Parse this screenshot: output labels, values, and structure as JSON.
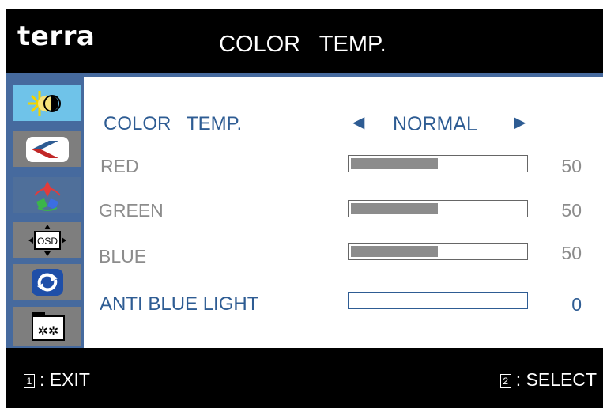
{
  "header": {
    "brand": "terra",
    "title": "COLOR   TEMP."
  },
  "sidebar": {
    "items": [
      {
        "icon": "brightness-contrast-icon",
        "active": true
      },
      {
        "icon": "image-adjust-icon"
      },
      {
        "icon": "color-icon",
        "active": true
      },
      {
        "icon": "osd-settings-icon"
      },
      {
        "icon": "reset-icon"
      },
      {
        "icon": "setup-icon"
      }
    ]
  },
  "menu": {
    "color_temp": {
      "label": "COLOR   TEMP.",
      "value": "NORMAL",
      "prev_arrow": "◀",
      "next_arrow": "▶"
    },
    "red": {
      "label": "RED",
      "value": 50
    },
    "green": {
      "label": "GREEN",
      "value": 50
    },
    "blue": {
      "label": "BLUE",
      "value": 50
    },
    "anti_blue_light": {
      "label": "ANTI BLUE LIGHT",
      "value": 0
    }
  },
  "footer": {
    "exit": {
      "key": "1",
      "label": ": EXIT"
    },
    "select": {
      "key": "2",
      "label": ": SELECT"
    }
  },
  "colors": {
    "accent": "#2e5c93",
    "sidebar": "#466a9e",
    "active_icon": "#6fc3e9",
    "text_gray": "#8c8c8c"
  }
}
